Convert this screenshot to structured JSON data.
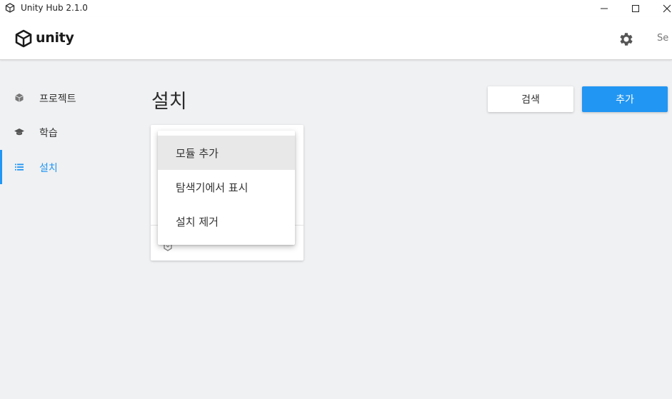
{
  "window": {
    "title": "Unity Hub 2.1.0",
    "controls": [
      "minimize",
      "maximize",
      "close"
    ]
  },
  "header": {
    "logo_text": "unity",
    "settings_icon": "gear-icon",
    "sign_in_partial": "Se"
  },
  "sidebar": {
    "items": [
      {
        "label": "프로젝트",
        "icon": "cube-icon",
        "active": false
      },
      {
        "label": "학습",
        "icon": "graduation-cap-icon",
        "active": false
      },
      {
        "label": "설치",
        "icon": "list-icon",
        "active": true
      }
    ]
  },
  "main": {
    "title": "설치",
    "search_button": "검색",
    "add_button": "추가"
  },
  "context_menu": {
    "items": [
      {
        "label": "모듈 추가",
        "hovered": true
      },
      {
        "label": "탐색기에서 표시",
        "hovered": false
      },
      {
        "label": "설치 제거",
        "hovered": false
      }
    ]
  },
  "colors": {
    "accent": "#2196f3",
    "background": "#f0f1f3",
    "surface": "#ffffff",
    "menu_hover": "#e8e8e8"
  }
}
